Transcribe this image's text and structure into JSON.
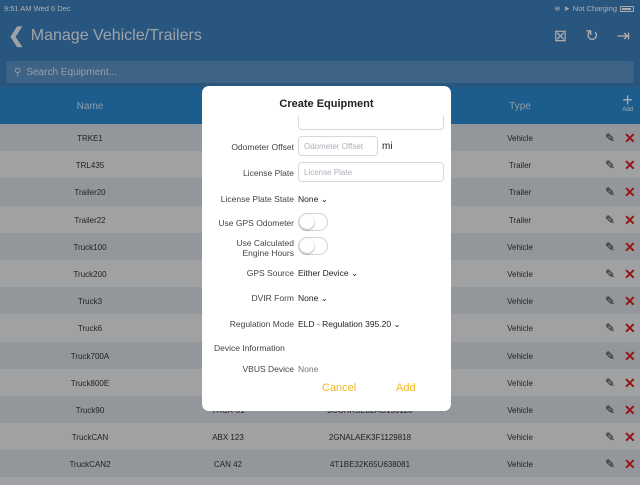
{
  "status": {
    "time": "9:51 AM",
    "date": "Wed 6 Dec",
    "signal": "➤",
    "charging": "Not Charging"
  },
  "nav": {
    "title": "Manage Vehicle/Trailers"
  },
  "search": {
    "placeholder": "Search Equipment..."
  },
  "table": {
    "headers": {
      "name": "Name",
      "type": "Type",
      "add": "Add"
    },
    "rows": [
      {
        "name": "TRKE1",
        "number": "",
        "vin": "",
        "type": "Vehicle"
      },
      {
        "name": "TRL435",
        "number": "",
        "vin": "",
        "type": "Trailer"
      },
      {
        "name": "Trailer20",
        "number": "",
        "vin": "",
        "type": "Trailer"
      },
      {
        "name": "Trailer22",
        "number": "",
        "vin": "",
        "type": "Trailer"
      },
      {
        "name": "Truck100",
        "number": "",
        "vin": "",
        "type": "Vehicle"
      },
      {
        "name": "Truck200",
        "number": "",
        "vin": "",
        "type": "Vehicle"
      },
      {
        "name": "Truck3",
        "number": "",
        "vin": "",
        "type": "Vehicle"
      },
      {
        "name": "Truck6",
        "number": "",
        "vin": "",
        "type": "Vehicle"
      },
      {
        "name": "Truck700A",
        "number": "",
        "vin": "",
        "type": "Vehicle"
      },
      {
        "name": "Truck800E",
        "number": "",
        "vin": "",
        "type": "Vehicle"
      },
      {
        "name": "Truck90",
        "number": "TRCK-01",
        "vin": "3GCRKSE32AG155128",
        "type": "Vehicle"
      },
      {
        "name": "TruckCAN",
        "number": "ABX 123",
        "vin": "2GNALAEK3F1129818",
        "type": "Vehicle"
      },
      {
        "name": "TruckCAN2",
        "number": "CAN 42",
        "vin": "4T1BE32K65U638081",
        "type": "Vehicle"
      }
    ]
  },
  "modal": {
    "title": "Create Equipment",
    "odometer_label": "Odometer Offset",
    "odometer_placeholder": "Odometer Offset",
    "odometer_unit": "mi",
    "plate_label": "License Plate",
    "plate_placeholder": "License Plate",
    "plate_state_label": "License Plate State",
    "plate_state_value": "None",
    "gps_odometer_label": "Use GPS Odometer",
    "calc_hours_label_1": "Use Calculated",
    "calc_hours_label_2": "Engine Hours",
    "gps_source_label": "GPS Source",
    "gps_source_value": "Either Device",
    "dvir_label": "DVIR Form",
    "dvir_value": "None",
    "regulation_label": "Regulation Mode",
    "regulation_value": "ELD - Regulation 395.20",
    "device_info_label": "Device Information",
    "vbus_label": "VBUS Device",
    "vbus_value": "None",
    "cancel_label": "Cancel",
    "add_label": "Add"
  },
  "colors": {
    "header_blue": "#3d7fbc",
    "table_header_blue": "#2a8ad2",
    "delete_red": "#d8231f",
    "action_yellow": "#f2b71e"
  }
}
